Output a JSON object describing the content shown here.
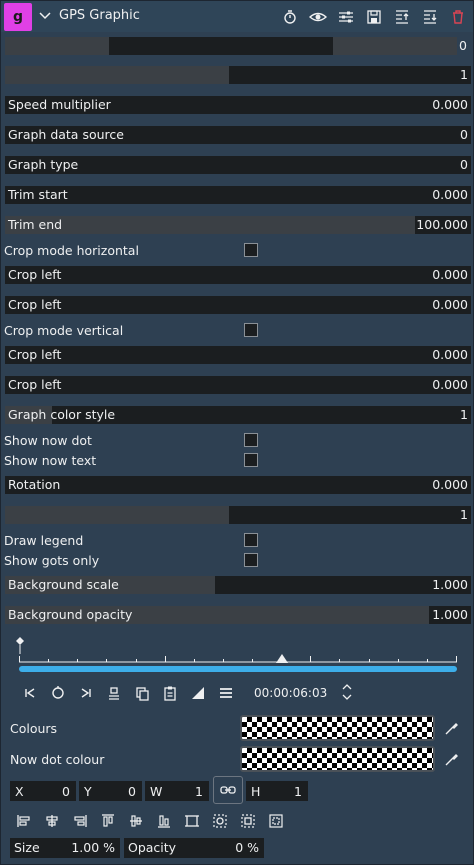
{
  "header": {
    "badge": "g",
    "title": "GPS Graphic"
  },
  "top_split": {
    "value": "0"
  },
  "params": [
    {
      "kind": "slider",
      "label": "",
      "value": "1",
      "fill": 0.48
    },
    {
      "kind": "slider",
      "label": "Speed multiplier",
      "value": "0.000",
      "fill": 0.0
    },
    {
      "kind": "slider",
      "label": "Graph data source",
      "value": "0",
      "fill": 0.0
    },
    {
      "kind": "slider",
      "label": "Graph type",
      "value": "0",
      "fill": 0.0
    },
    {
      "kind": "slider",
      "label": "Trim start",
      "value": "0.000",
      "fill": 0.0
    },
    {
      "kind": "slider",
      "label": "Trim end",
      "value": "100.000",
      "fill": 0.88
    },
    {
      "kind": "check",
      "label": "Crop mode horizontal",
      "checked": false
    },
    {
      "kind": "slider",
      "label": "Crop left",
      "value": "0.000",
      "fill": 0.0
    },
    {
      "kind": "slider",
      "label": "Crop left",
      "value": "0.000",
      "fill": 0.0
    },
    {
      "kind": "check",
      "label": "Crop mode vertical",
      "checked": false
    },
    {
      "kind": "slider",
      "label": "Crop left",
      "value": "0.000",
      "fill": 0.0
    },
    {
      "kind": "slider",
      "label": "Crop left",
      "value": "0.000",
      "fill": 0.0
    },
    {
      "kind": "slider",
      "label": "Graph color style",
      "value": "1",
      "fill": 0.1
    },
    {
      "kind": "check",
      "label": "Show now dot",
      "checked": false
    },
    {
      "kind": "check",
      "label": "Show now text",
      "checked": false
    },
    {
      "kind": "slider",
      "label": "Rotation",
      "value": "0.000",
      "fill": 0.0
    },
    {
      "kind": "slider",
      "label": "",
      "value": "1",
      "fill": 0.48
    },
    {
      "kind": "check",
      "label": "Draw legend",
      "checked": false
    },
    {
      "kind": "check",
      "label": "Show gots only",
      "checked": false
    },
    {
      "kind": "slider",
      "label": "Background scale",
      "value": "1.000",
      "fill": 0.45
    },
    {
      "kind": "slider",
      "label": "Background opacity",
      "value": "1.000",
      "fill": 0.91
    }
  ],
  "transport": {
    "timecode": "00:00:06:03",
    "playhead": 0.6
  },
  "colours": {
    "colours_label": "Colours",
    "now_dot_label": "Now dot colour"
  },
  "geometry": {
    "x_label": "X",
    "x_value": "0",
    "y_label": "Y",
    "y_value": "0",
    "w_label": "W",
    "w_value": "1",
    "h_label": "H",
    "h_value": "1"
  },
  "bottom": {
    "size_label": "Size",
    "size_value": "1.00 %",
    "opacity_label": "Opacity",
    "opacity_value": "0 %"
  },
  "colors": {
    "accent": "#3daee9",
    "badge": "#e040e6",
    "panel": "#2e4052",
    "field": "#1b1e20",
    "delete": "#da4453"
  }
}
